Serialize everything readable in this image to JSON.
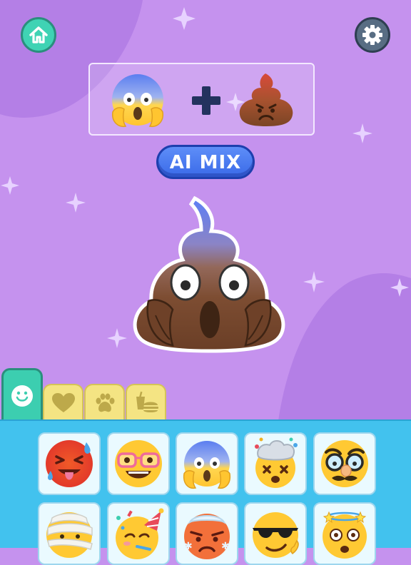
{
  "header": {
    "home_button": {
      "icon": "home-icon"
    },
    "settings_button": {
      "icon": "gear-icon"
    }
  },
  "combo": {
    "left_emoji": "face-screaming-in-fear",
    "operator": "+",
    "right_emoji": "angry-pile-of-poo"
  },
  "mix_button": {
    "label": "AI MIX"
  },
  "result": {
    "emoji": "screaming-pile-of-poo"
  },
  "tabs": [
    {
      "id": "smileys",
      "icon": "smiley-icon",
      "selected": true
    },
    {
      "id": "hearts",
      "icon": "heart-icon",
      "selected": false
    },
    {
      "id": "animals",
      "icon": "paw-icon",
      "selected": false
    },
    {
      "id": "food",
      "icon": "food-icon",
      "selected": false
    }
  ],
  "emoji_grid": [
    {
      "name": "tongue-out-sweating-face"
    },
    {
      "name": "nerd-glasses-face"
    },
    {
      "name": "face-screaming-in-fear"
    },
    {
      "name": "exploding-head"
    },
    {
      "name": "disguised-face"
    },
    {
      "name": "mummy-face"
    },
    {
      "name": "partying-face"
    },
    {
      "name": "cold-angry-face"
    },
    {
      "name": "smiling-face-with-sunglasses"
    },
    {
      "name": "dizzy-face"
    }
  ],
  "colors": {
    "background": "#c592ee",
    "accent_teal": "#3fd3b4",
    "mix_button": "#4a7af0",
    "tray": "#42c2ee",
    "tab_inactive": "#f4e483"
  }
}
